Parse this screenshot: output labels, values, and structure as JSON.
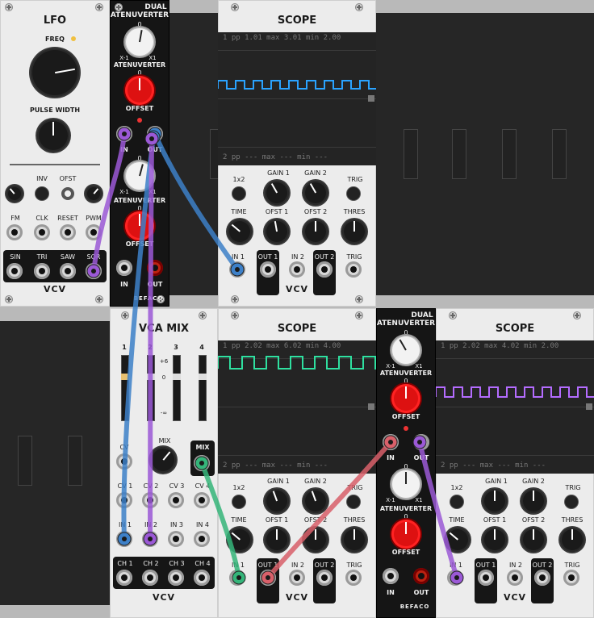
{
  "app": "VCV Rack",
  "lfo": {
    "title": "LFO",
    "freq": "FREQ",
    "pulse_width": "PULSE WIDTH",
    "inv": "INV",
    "ofst": "OFST",
    "fm": "FM",
    "clk": "CLK",
    "reset": "RESET",
    "pwm": "PWM",
    "sin": "SIN",
    "tri": "TRI",
    "saw": "SAW",
    "sqr": "SQR",
    "brand": "VCV"
  },
  "atten1": {
    "title1": "DUAL",
    "title2": "ATENUVERTER",
    "atten_label": "ATENUVERTER",
    "offset": "OFFSET",
    "in": "IN",
    "out": "OUT",
    "x_neg": "X-1",
    "x_pos": "X1",
    "zero": "0",
    "brand": "BEFACO"
  },
  "scope1": {
    "title": "SCOPE",
    "ch1_header": "1  pp   1.01   max   3.01  min   2.00",
    "ch2_header": "2  pp   ---    max   ---   min   ---",
    "x1x2": "1x2",
    "gain1": "GAIN 1",
    "gain2": "GAIN 2",
    "trig_btn": "TRIG",
    "time": "TIME",
    "ofst1": "OFST 1",
    "ofst2": "OFST 2",
    "thres": "THRES",
    "in1": "IN 1",
    "out1": "OUT 1",
    "in2": "IN 2",
    "out2": "OUT 2",
    "trig": "TRIG",
    "brand": "VCV",
    "trace_color": "#2aa3ff"
  },
  "vcamix": {
    "title": "VCA MIX",
    "ch_nums": [
      "1",
      "2",
      "3",
      "4"
    ],
    "plus6": "+6",
    "zero": "0",
    "minus_inf": "-∞",
    "cv": "CV",
    "mix": "MIX",
    "mix_out": "MIX",
    "cv1": "CV 1",
    "cv2": "CV 2",
    "cv3": "CV 3",
    "cv4": "CV 4",
    "in1": "IN 1",
    "in2": "IN 2",
    "in3": "IN 3",
    "in4": "IN 4",
    "ch1": "CH 1",
    "ch2": "CH 2",
    "ch3": "CH 3",
    "ch4": "CH 4",
    "brand": "VCV"
  },
  "scope2": {
    "title": "SCOPE",
    "ch1_header": "1  pp   2.02   max   6.02  min   4.00",
    "ch2_header": "2  pp   ---    max   ---   min   ---",
    "x1x2": "1x2",
    "gain1": "GAIN 1",
    "gain2": "GAIN 2",
    "trig_btn": "TRIG",
    "time": "TIME",
    "ofst1": "OFST 1",
    "ofst2": "OFST 2",
    "thres": "THRES",
    "in1": "IN 1",
    "out1": "OUT 1",
    "in2": "IN 2",
    "out2": "OUT 2",
    "trig": "TRIG",
    "brand": "VCV",
    "trace_color": "#2fe0a0"
  },
  "atten2": {
    "title1": "DUAL",
    "title2": "ATENUVERTER",
    "atten_label": "ATENUVERTER",
    "offset": "OFFSET",
    "in": "IN",
    "out": "OUT",
    "x_neg": "X-1",
    "x_pos": "X1",
    "zero": "0",
    "brand": "BEFACO"
  },
  "scope3": {
    "title": "SCOPE",
    "ch1_header": "1  pp   2.02   max   4.02  min   2.00",
    "ch2_header": "2  pp   ---    max   ---   min   ---",
    "x1x2": "1x2",
    "gain1": "GAIN 1",
    "gain2": "GAIN 2",
    "trig_btn": "TRIG",
    "time": "TIME",
    "ofst1": "OFST 1",
    "ofst2": "OFST 2",
    "thres": "THRES",
    "in1": "IN 1",
    "out1": "OUT 1",
    "in2": "IN 2",
    "out2": "OUT 2",
    "trig": "TRIG",
    "brand": "VCV",
    "trace_color": "#b46cff"
  },
  "cable_colors": {
    "purple": "#9b59d6",
    "blue": "#3d80c8",
    "green": "#35b57a",
    "red": "#d9606a"
  }
}
